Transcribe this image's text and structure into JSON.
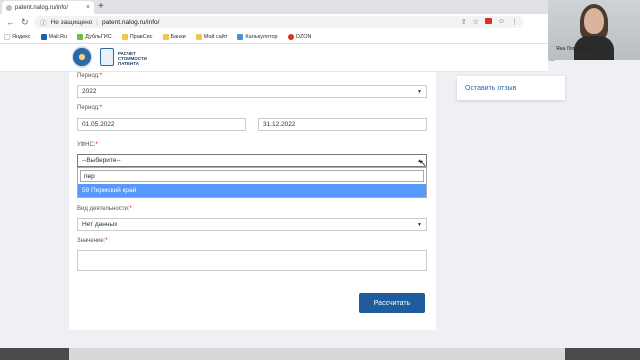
{
  "browser": {
    "tab_title": "patent.nalog.ru/info/",
    "tab_close": "×",
    "new_tab": "+",
    "nav": {
      "back": "←",
      "forward": "→",
      "reload": "↻"
    },
    "security_text": "Не защищено",
    "url": "patent.nalog.ru/info/",
    "bookmarks": [
      {
        "label": "Яндекс",
        "color": "#ffffff"
      },
      {
        "label": "Mail.Ru",
        "color": "#1e5fa8"
      },
      {
        "label": "ДубльГИС",
        "color": "#6fbf3f"
      },
      {
        "label": "ПравСис",
        "color": "#f2c744"
      },
      {
        "label": "Банки",
        "color": "#f2c744"
      },
      {
        "label": "Мой сайт",
        "color": "#f2c744"
      },
      {
        "label": "Калькулятор",
        "color": "#4a90d9"
      },
      {
        "label": "OZON",
        "color": "#d93025"
      }
    ]
  },
  "header": {
    "logo_text": "Расчет стоимости патента"
  },
  "form": {
    "period_label": "Период:",
    "period_value": "2022",
    "period_dates_label": "Период:",
    "date_from": "01.05.2022",
    "date_to": "31.12.2022",
    "ufns_label": "УФНС:",
    "ufns_value": "--Выберите--",
    "ufns_search": "пер",
    "ufns_option": "59 Пермский край",
    "activity_label": "Вид деятельности:",
    "activity_value": "Нет данных",
    "value_label": "Значение:",
    "value_input": "",
    "required_mark": "*",
    "calc_button": "Рассчитать"
  },
  "sidebar": {
    "feedback_link": "Оставить отзыв"
  },
  "webcam": {
    "name": "Яна Лопатина"
  },
  "colors": {
    "primary": "#1f5c9c",
    "option_highlight": "#5897fb",
    "link": "#2a6aa8"
  }
}
